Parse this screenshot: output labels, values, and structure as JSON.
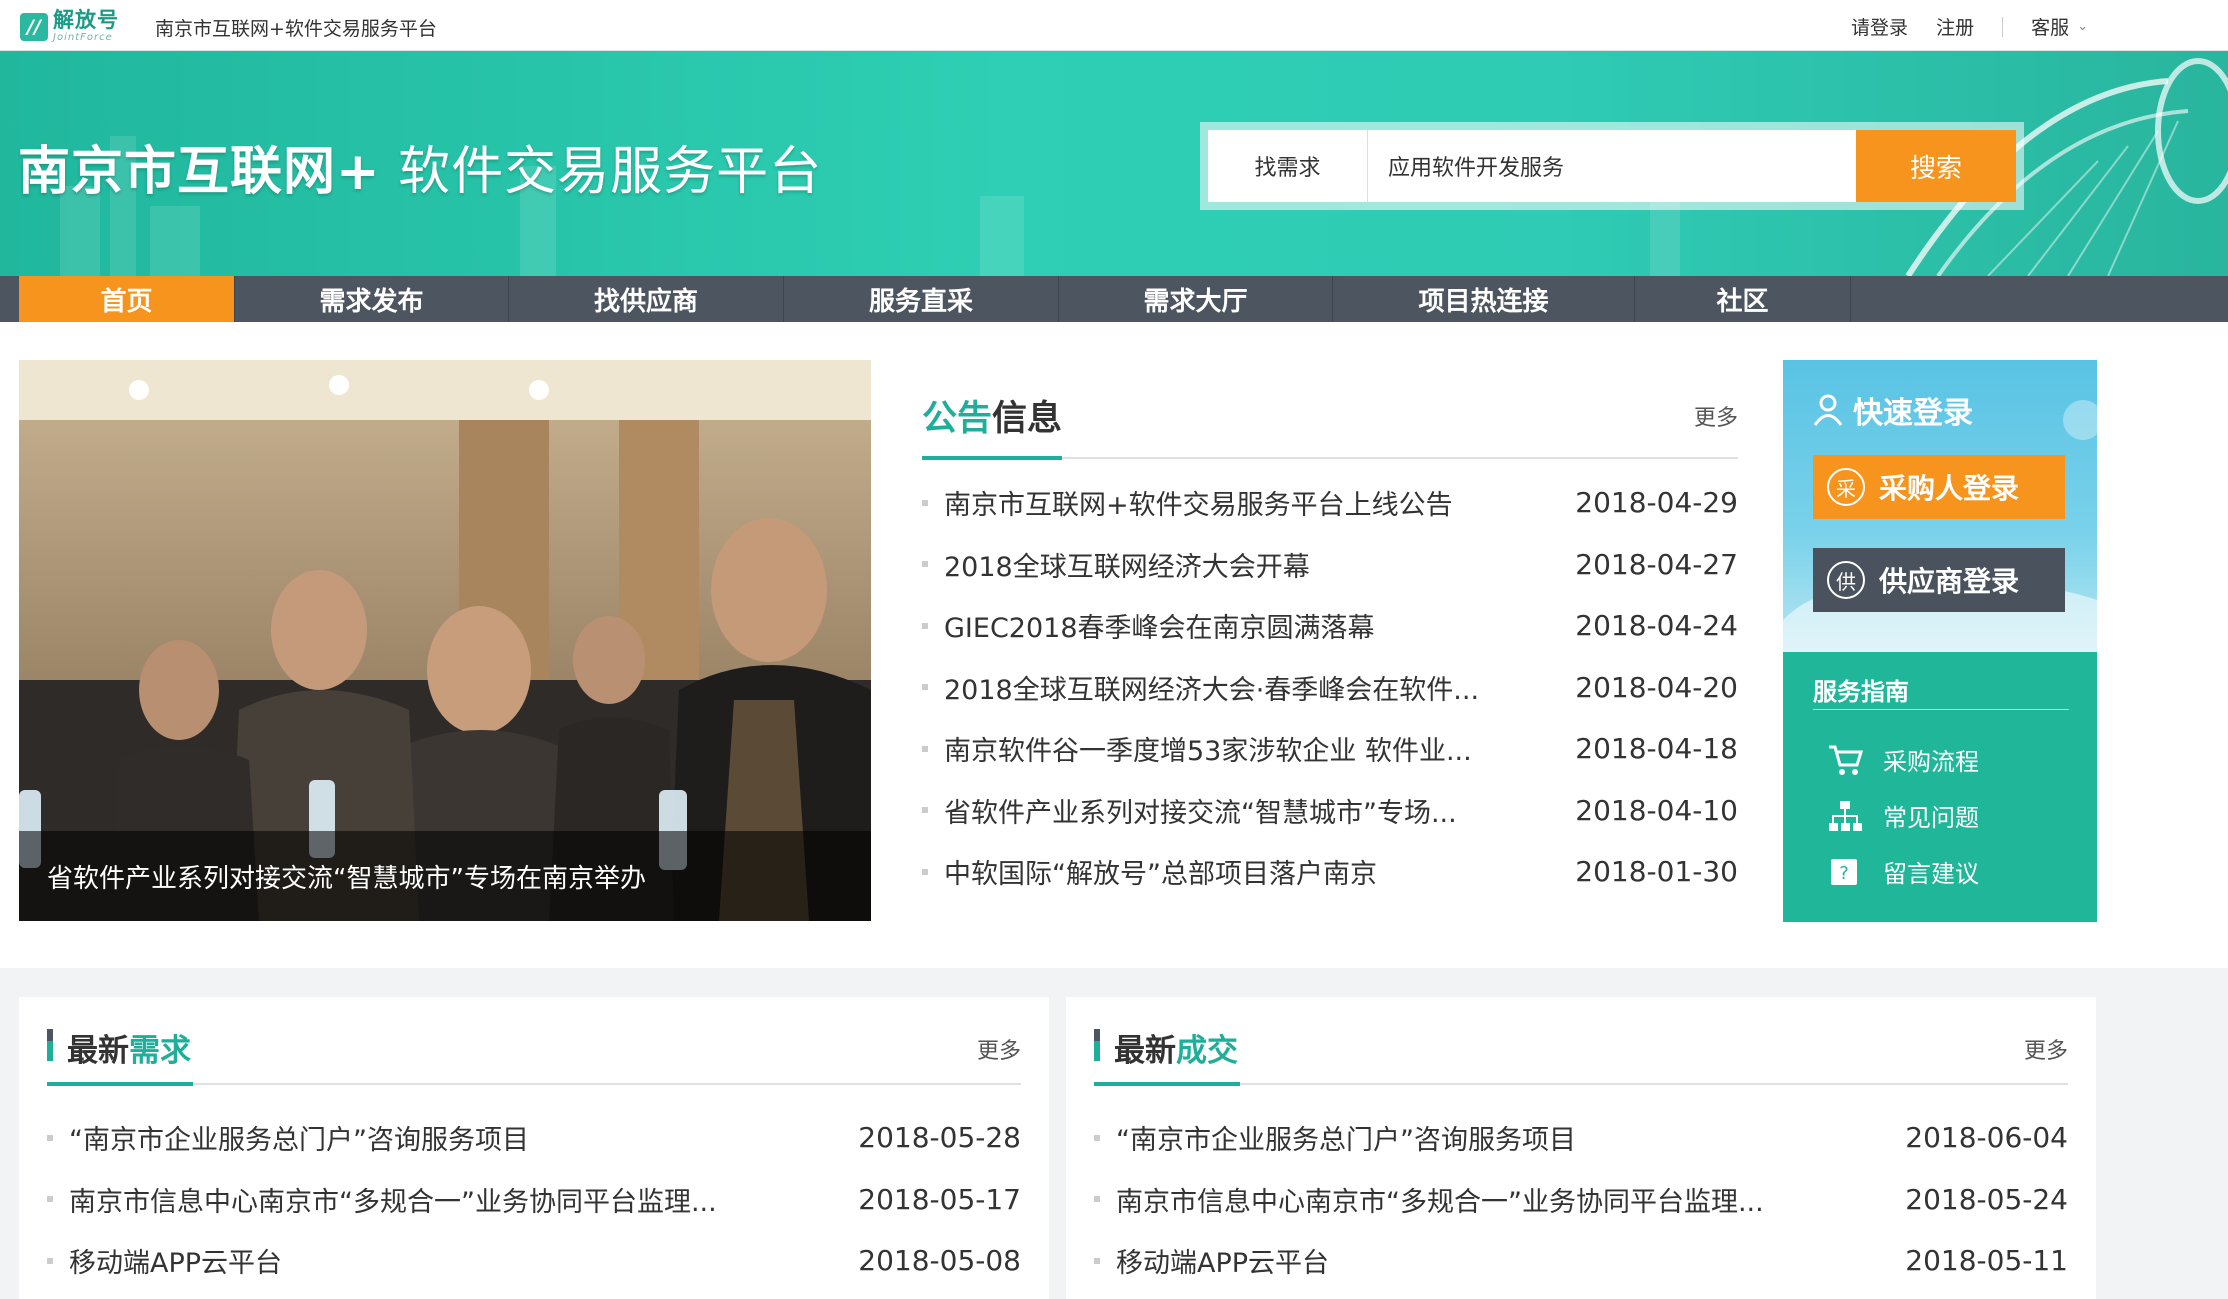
{
  "topbar": {
    "logo_cn": "解放号",
    "logo_en": "JointForce",
    "site_title": "南京市互联网+软件交易服务平台",
    "login": "请登录",
    "register": "注册",
    "service": "客服"
  },
  "banner": {
    "title_bold": "南京市互联网+",
    "title_light": " 软件交易服务平台",
    "search_label": "找需求",
    "search_value": "应用软件开发服务",
    "search_button": "搜索"
  },
  "nav": [
    "首页",
    "需求发布",
    "找供应商",
    "服务直采",
    "需求大厅",
    "项目热连接",
    "社区"
  ],
  "photo": {
    "caption": "省软件产业系列对接交流“智慧城市”专场在南京举办"
  },
  "notice": {
    "title_hl": "公告",
    "title_rest": "信息",
    "more": "更多",
    "items": [
      {
        "title": "南京市互联网+软件交易服务平台上线公告",
        "date": "2018-04-29"
      },
      {
        "title": "2018全球互联网经济大会开幕",
        "date": "2018-04-27"
      },
      {
        "title": "GIEC2018春季峰会在南京圆满落幕",
        "date": "2018-04-24"
      },
      {
        "title": "2018全球互联网经济大会·春季峰会在软件...",
        "date": "2018-04-20"
      },
      {
        "title": "南京软件谷一季度增53家涉软企业 软件业...",
        "date": "2018-04-18"
      },
      {
        "title": "省软件产业系列对接交流“智慧城市”专场...",
        "date": "2018-04-10"
      },
      {
        "title": "中软国际“解放号”总部项目落户南京",
        "date": "2018-01-30"
      }
    ]
  },
  "login_panel": {
    "title": "快速登录",
    "buyer_icon": "采",
    "buyer_label": "采购人登录",
    "supplier_icon": "供",
    "supplier_label": "供应商登录",
    "guide_title": "服务指南",
    "guide": [
      {
        "label": "采购流程",
        "icon": "cart-icon"
      },
      {
        "label": "常见问题",
        "icon": "sitemap-icon"
      },
      {
        "label": "留言建议",
        "icon": "message-icon"
      }
    ]
  },
  "demand": {
    "title_a": "最新",
    "title_b": "需求",
    "more": "更多",
    "items": [
      {
        "title": "“南京市企业服务总门户”咨询服务项目",
        "date": "2018-05-28"
      },
      {
        "title": "南京市信息中心南京市“多规合一”业务协同平台监理...",
        "date": "2018-05-17"
      },
      {
        "title": "移动端APP云平台",
        "date": "2018-05-08"
      }
    ]
  },
  "deals": {
    "title_a": "最新",
    "title_b": "成交",
    "more": "更多",
    "items": [
      {
        "title": "“南京市企业服务总门户”咨询服务项目",
        "date": "2018-06-04"
      },
      {
        "title": "南京市信息中心南京市“多规合一”业务协同平台监理...",
        "date": "2018-05-24"
      },
      {
        "title": "移动端APP云平台",
        "date": "2018-05-11"
      }
    ]
  },
  "colors": {
    "accent": "#1eae9a",
    "orange": "#f7941d",
    "nav_bg": "#4d5560"
  }
}
